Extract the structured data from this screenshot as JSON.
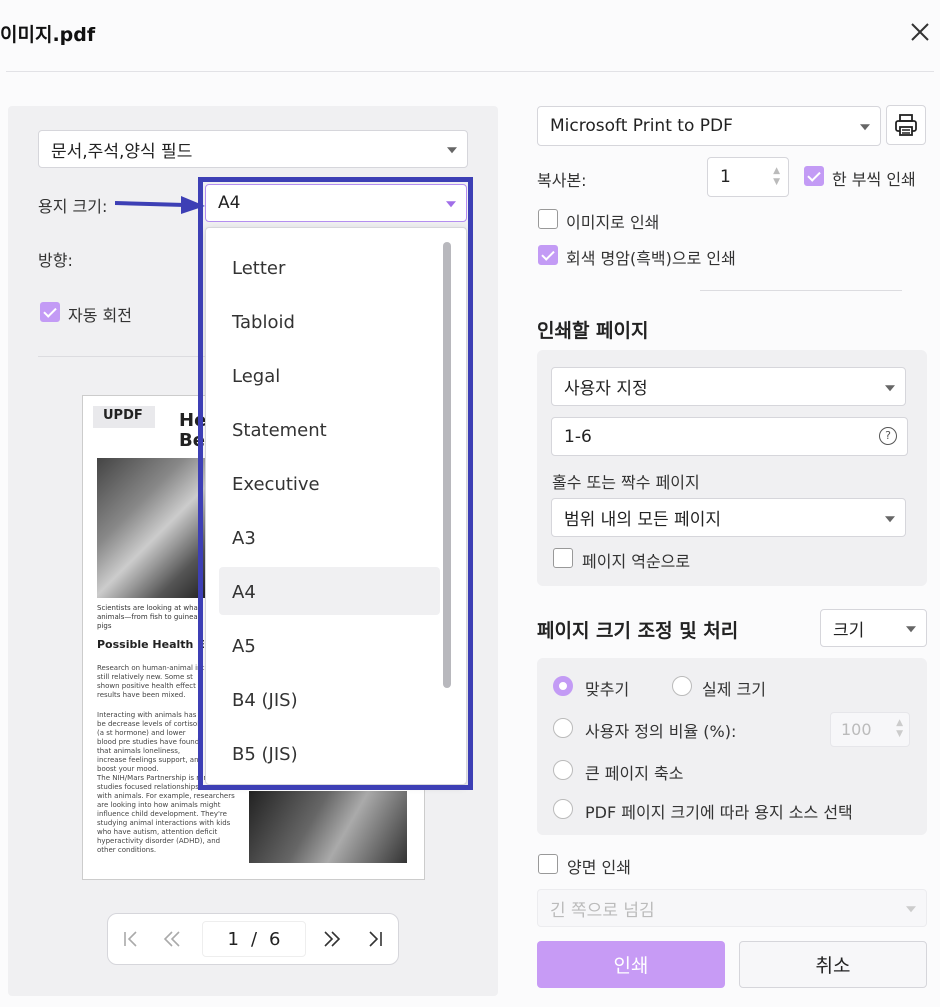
{
  "window": {
    "title": "이미지.pdf"
  },
  "left": {
    "content_select": "문서,주석,양식 필드",
    "paper_size_label": "용지 크기:",
    "paper_size_value": "A4",
    "orientation_label": "방향:",
    "auto_rotate_label": "자동 회전",
    "paper_sizes": [
      "Letter",
      "Tabloid",
      "Legal",
      "Statement",
      "Executive",
      "A3",
      "A4",
      "A5",
      "B4 (JIS)",
      "B5 (JIS)"
    ],
    "selected_paper": "A4",
    "preview": {
      "logo": "UPDF",
      "title_a": "Health",
      "title_b": "Be",
      "intro": "Scientists are looking at what animals—from fish to guinea pigs",
      "heading": "Possible Health Effe",
      "p1": "Research on human-animal int still relatively new. Some st shown positive health effect results have been mixed.",
      "p2": "Interacting with animals has be decrease levels of cortisol (a st hormone) and lower blood pre studies have found that animals loneliness, increase feelings support, and boost your mood.",
      "p3": "The NIH/Mars Partnership is range of studies focused relationships we have with animals. For example, researchers are looking into how animals might influence child development. They're studying animal interactions with kids who have autism, attention deficit hyperactivity disorder (ADHD), and other conditions."
    },
    "pager": {
      "current": "1",
      "sep": "/",
      "total": "6"
    }
  },
  "right": {
    "printer": "Microsoft Print to PDF",
    "copies_label": "복사본:",
    "copies_value": "1",
    "collate_label": "한 부씩 인쇄",
    "print_as_image_label": "이미지로 인쇄",
    "grayscale_label": "회색 명암(흑백)으로 인쇄",
    "pages_heading": "인쇄할 페이지",
    "page_range_select": "사용자 지정",
    "page_range_value": "1-6",
    "odd_even_label": "홀수 또는 짝수 페이지",
    "odd_even_select": "범위 내의 모든 페이지",
    "reverse_label": "페이지 역순으로",
    "sizing_heading": "페이지 크기 조정 및 처리",
    "sizing_select": "크기",
    "fit_label": "맞추기",
    "actual_size_label": "실제 크기",
    "custom_scale_label": "사용자 정의 비율 (%):",
    "custom_scale_value": "100",
    "shrink_label": "큰 페이지 축소",
    "pdf_source_label": "PDF 페이지 크기에 따라 용지 소스 선택",
    "duplex_label": "양면 인쇄",
    "flip_select": "긴 쪽으로 넘김",
    "print_button": "인쇄",
    "cancel_button": "취소"
  },
  "colors": {
    "accent": "#c39bf5",
    "highlight": "#3d3fb5"
  }
}
